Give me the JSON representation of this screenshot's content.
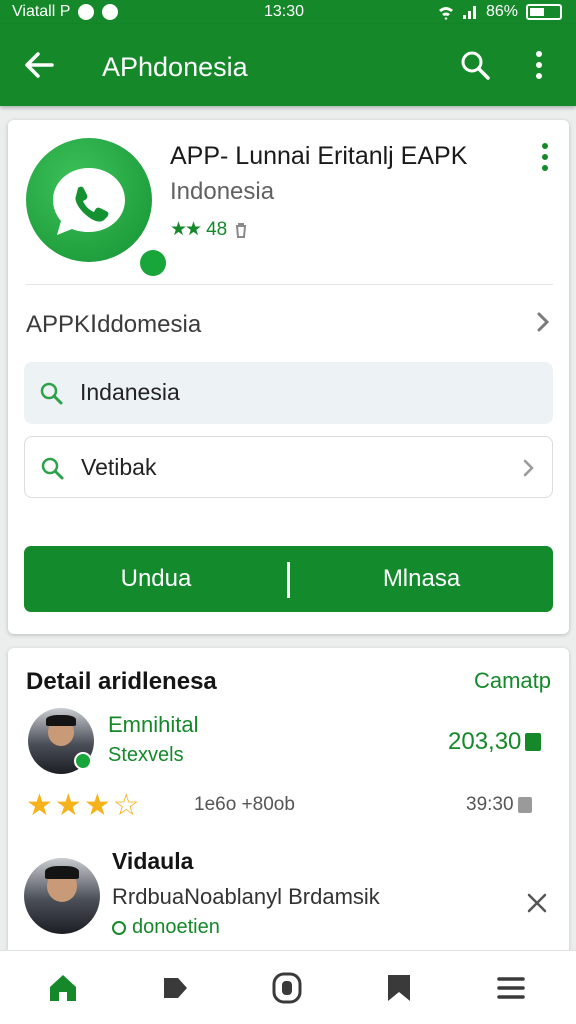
{
  "status_bar": {
    "left_text": "Viatall Р",
    "time": "13:30",
    "battery_text": "86%"
  },
  "appbar": {
    "title": "APhdonesia",
    "back_icon": "arrow-back-icon",
    "search_icon": "search-icon",
    "more_icon": "more-vert-icon"
  },
  "app_card": {
    "name": "APP- Lunnai Eritanlj EAPK",
    "subtitle": "Indonesia",
    "rating_stars": "★★",
    "rating_value": "48",
    "link_row_label": "APPKⅠddomesia",
    "field1_text": "Indanesia",
    "field2_text": "Vetibak",
    "action_left": "Undua",
    "action_right": "Mlnasa",
    "colors": {
      "brand": "#15892a",
      "field_bg": "#edf2f5"
    }
  },
  "details": {
    "title": "Detail aridlenesa",
    "action": "Camatp",
    "review1": {
      "name": "Emnihital",
      "sub": "Stexvels",
      "price": "203,30",
      "stars": [
        "★",
        "★",
        "★",
        "☆"
      ],
      "rating": 3.5,
      "meta": "1e6o +80ob",
      "time": "39:30"
    },
    "review2": {
      "name": "Vidaula",
      "sub": "RrdbuaNoablanyl Brdamsik",
      "link": "donoetien"
    }
  },
  "bottom_nav": [
    "home-icon",
    "tag-icon",
    "shield-icon",
    "bookmark-icon",
    "menu-icon"
  ]
}
